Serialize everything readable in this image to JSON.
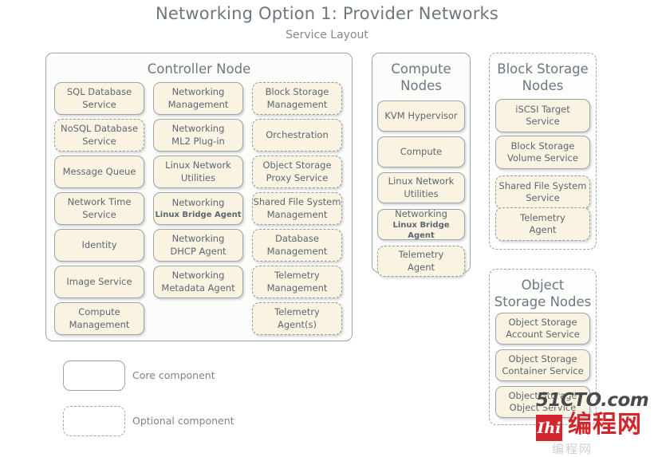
{
  "title": "Networking Option 1: Provider Networks",
  "subtitle": "Service Layout",
  "groups": {
    "controller": {
      "name": "Controller Node",
      "style": "solid",
      "columns": [
        [
          {
            "label": "SQL Database\nService",
            "type": "core"
          },
          {
            "label": "NoSQL Database\nService",
            "type": "optional"
          },
          {
            "label": "Message Queue",
            "type": "core"
          },
          {
            "label": "Network Time\nService",
            "type": "core"
          },
          {
            "label": "Identity",
            "type": "core"
          },
          {
            "label": "Image Service",
            "type": "core"
          },
          {
            "label": "Compute\nManagement",
            "type": "core"
          }
        ],
        [
          {
            "label": "Networking\nManagement",
            "type": "core"
          },
          {
            "label": "Networking\nML2 Plug-in",
            "type": "core"
          },
          {
            "label": "Linux Network\nUtilities",
            "type": "core"
          },
          {
            "label": "Networking",
            "sublabel": "Linux Bridge Agent",
            "type": "core"
          },
          {
            "label": "Networking\nDHCP Agent",
            "type": "core"
          },
          {
            "label": "Networking\nMetadata Agent",
            "type": "core"
          }
        ],
        [
          {
            "label": "Block Storage\nManagement",
            "type": "optional"
          },
          {
            "label": "Orchestration",
            "type": "optional"
          },
          {
            "label": "Object Storage\nProxy Service",
            "type": "optional"
          },
          {
            "label": "Shared File System\nManagement",
            "type": "optional"
          },
          {
            "label": "Database\nManagement",
            "type": "optional"
          },
          {
            "label": "Telemetry\nManagement",
            "type": "optional"
          },
          {
            "label": "Telemetry\nAgent(s)",
            "type": "optional"
          }
        ]
      ]
    },
    "compute": {
      "name": "Compute\nNodes",
      "style": "solid",
      "items": [
        {
          "label": "KVM Hypervisor",
          "type": "core"
        },
        {
          "label": "Compute",
          "type": "core"
        },
        {
          "label": "Linux Network\nUtilities",
          "type": "core"
        },
        {
          "label": "Networking",
          "sublabel": "Linux Bridge Agent",
          "type": "core"
        },
        {
          "label": "Telemetry\nAgent",
          "type": "optional"
        }
      ]
    },
    "block_storage": {
      "name": "Block Storage\nNodes",
      "style": "dashed",
      "items": [
        {
          "label": "iSCSI Target\nService",
          "type": "core"
        },
        {
          "label": "Block Storage\nVolume Service",
          "type": "core"
        },
        {
          "label": "Shared File System\nService",
          "type": "optional"
        },
        {
          "label": "Telemetry\nAgent",
          "type": "optional"
        }
      ]
    },
    "object_storage": {
      "name": "Object\nStorage Nodes",
      "style": "dashed",
      "items": [
        {
          "label": "Object Storage\nAccount Service",
          "type": "core"
        },
        {
          "label": "Object Storage\nContainer Service",
          "type": "core"
        },
        {
          "label": "Object Storage\nObject Service",
          "type": "core"
        }
      ]
    }
  },
  "legend": [
    {
      "type": "core",
      "label": "Core component"
    },
    {
      "type": "optional",
      "label": "Optional component"
    }
  ],
  "watermark": {
    "top": "51CTO.com",
    "mark": "Ihi",
    "cn": "编程网",
    "faint": "编程网"
  },
  "colors": {
    "service_fill": "#faf3e2",
    "border": "#9aa5ae",
    "text": "#5d6670",
    "title": "#6c7782",
    "watermark_red": "#d1262c"
  }
}
